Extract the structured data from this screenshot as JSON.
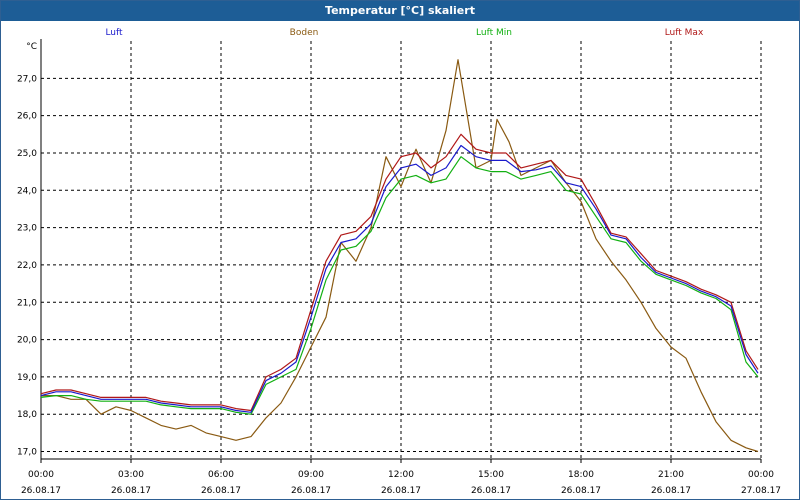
{
  "title": "Temperatur [°C] skaliert",
  "colors": {
    "titlebar": "#1d5d96",
    "luft": "#1a1acc",
    "boden": "#8a5a12",
    "luft_min": "#12b012",
    "luft_max": "#b01818"
  },
  "chart_data": {
    "type": "line",
    "title": "Temperatur [°C] skaliert",
    "ylabel": "°C",
    "ylim": [
      16.8,
      28.0
    ],
    "xlim_hours": [
      0,
      24
    ],
    "grid": true,
    "legend_placement": "top",
    "y_ticks": [
      "17,0",
      "18,0",
      "19,0",
      "20,0",
      "21,0",
      "22,0",
      "23,0",
      "24,0",
      "25,0",
      "26,0",
      "27,0"
    ],
    "x_ticks": [
      {
        "time": "00:00",
        "date": "26.08.17"
      },
      {
        "time": "03:00",
        "date": "26.08.17"
      },
      {
        "time": "06:00",
        "date": "26.08.17"
      },
      {
        "time": "09:00",
        "date": "26.08.17"
      },
      {
        "time": "12:00",
        "date": "26.08.17"
      },
      {
        "time": "15:00",
        "date": "26.08.17"
      },
      {
        "time": "18:00",
        "date": "26.08.17"
      },
      {
        "time": "21:00",
        "date": "26.08.17"
      },
      {
        "time": "00:00",
        "date": "27.08.17"
      }
    ],
    "series": [
      {
        "name": "Luft",
        "color": "#1a1acc",
        "x": [
          0.0,
          0.5,
          1.0,
          1.5,
          2.0,
          2.5,
          3.0,
          3.5,
          4.0,
          4.5,
          5.0,
          5.5,
          6.0,
          6.5,
          7.0,
          7.5,
          8.0,
          8.5,
          9.0,
          9.5,
          10.0,
          10.5,
          11.0,
          11.5,
          12.0,
          12.5,
          13.0,
          13.5,
          14.0,
          14.5,
          15.0,
          15.5,
          16.0,
          16.5,
          17.0,
          17.5,
          18.0,
          18.5,
          19.0,
          19.5,
          20.0,
          20.5,
          21.0,
          21.5,
          22.0,
          22.5,
          23.0,
          23.5,
          23.9
        ],
        "y": [
          18.5,
          18.6,
          18.6,
          18.5,
          18.4,
          18.4,
          18.4,
          18.4,
          18.3,
          18.25,
          18.2,
          18.2,
          18.2,
          18.1,
          18.05,
          18.9,
          19.1,
          19.4,
          20.6,
          21.9,
          22.6,
          22.7,
          23.1,
          24.1,
          24.6,
          24.7,
          24.4,
          24.6,
          25.2,
          24.9,
          24.8,
          24.8,
          24.5,
          24.55,
          24.65,
          24.2,
          24.1,
          23.5,
          22.8,
          22.7,
          22.2,
          21.8,
          21.65,
          21.5,
          21.3,
          21.15,
          20.9,
          19.6,
          19.1
        ]
      },
      {
        "name": "Boden",
        "color": "#8a5a12",
        "x": [
          0.0,
          0.5,
          1.0,
          1.5,
          2.0,
          2.5,
          3.0,
          3.5,
          4.0,
          4.5,
          5.0,
          5.5,
          6.0,
          6.5,
          7.0,
          7.5,
          8.0,
          8.5,
          9.0,
          9.5,
          10.0,
          10.5,
          11.0,
          11.5,
          12.0,
          12.5,
          13.0,
          13.5,
          13.9,
          14.5,
          15.0,
          15.2,
          15.6,
          16.0,
          16.5,
          17.0,
          17.5,
          18.0,
          18.5,
          19.0,
          19.5,
          20.0,
          20.5,
          21.0,
          21.5,
          22.0,
          22.5,
          23.0,
          23.5,
          23.9
        ],
        "y": [
          18.5,
          18.5,
          18.4,
          18.4,
          18.0,
          18.2,
          18.1,
          17.9,
          17.7,
          17.6,
          17.7,
          17.5,
          17.4,
          17.3,
          17.4,
          17.9,
          18.3,
          19.0,
          19.8,
          20.6,
          22.6,
          22.1,
          23.0,
          24.9,
          24.1,
          25.1,
          24.2,
          25.6,
          27.5,
          24.6,
          24.8,
          25.9,
          25.3,
          24.4,
          24.6,
          24.8,
          24.2,
          23.7,
          22.7,
          22.1,
          21.6,
          21.0,
          20.3,
          19.8,
          19.5,
          18.6,
          17.8,
          17.3,
          17.1,
          17.0
        ]
      },
      {
        "name": "Luft Min",
        "color": "#12b012",
        "x": [
          0.0,
          0.5,
          1.0,
          1.5,
          2.0,
          2.5,
          3.0,
          3.5,
          4.0,
          4.5,
          5.0,
          5.5,
          6.0,
          6.5,
          7.0,
          7.5,
          8.0,
          8.5,
          9.0,
          9.5,
          10.0,
          10.5,
          11.0,
          11.5,
          12.0,
          12.5,
          13.0,
          13.5,
          14.0,
          14.5,
          15.0,
          15.5,
          16.0,
          16.5,
          17.0,
          17.5,
          18.0,
          18.5,
          19.0,
          19.5,
          20.0,
          20.5,
          21.0,
          21.5,
          22.0,
          22.5,
          23.0,
          23.5,
          23.9
        ],
        "y": [
          18.45,
          18.5,
          18.5,
          18.4,
          18.35,
          18.35,
          18.35,
          18.35,
          18.25,
          18.2,
          18.15,
          18.15,
          18.15,
          18.05,
          18.0,
          18.8,
          19.0,
          19.2,
          20.3,
          21.6,
          22.4,
          22.5,
          22.9,
          23.8,
          24.3,
          24.4,
          24.2,
          24.3,
          24.9,
          24.6,
          24.5,
          24.5,
          24.3,
          24.4,
          24.5,
          24.0,
          23.9,
          23.3,
          22.7,
          22.6,
          22.1,
          21.75,
          21.6,
          21.45,
          21.25,
          21.1,
          20.8,
          19.4,
          19.0
        ]
      },
      {
        "name": "Luft Max",
        "color": "#b01818",
        "x": [
          0.0,
          0.5,
          1.0,
          1.5,
          2.0,
          2.5,
          3.0,
          3.5,
          4.0,
          4.5,
          5.0,
          5.5,
          6.0,
          6.5,
          7.0,
          7.5,
          8.0,
          8.5,
          9.0,
          9.5,
          10.0,
          10.5,
          11.0,
          11.5,
          12.0,
          12.5,
          13.0,
          13.5,
          14.0,
          14.5,
          15.0,
          15.5,
          16.0,
          16.5,
          17.0,
          17.5,
          18.0,
          18.5,
          19.0,
          19.5,
          20.0,
          20.5,
          21.0,
          21.5,
          22.0,
          22.5,
          23.0,
          23.5,
          23.9
        ],
        "y": [
          18.55,
          18.65,
          18.65,
          18.55,
          18.45,
          18.45,
          18.45,
          18.45,
          18.35,
          18.3,
          18.25,
          18.25,
          18.25,
          18.15,
          18.1,
          19.0,
          19.2,
          19.5,
          20.8,
          22.1,
          22.8,
          22.9,
          23.3,
          24.3,
          24.9,
          25.0,
          24.6,
          24.9,
          25.5,
          25.1,
          25.0,
          25.0,
          24.6,
          24.7,
          24.8,
          24.4,
          24.3,
          23.6,
          22.85,
          22.75,
          22.3,
          21.85,
          21.7,
          21.55,
          21.35,
          21.2,
          21.0,
          19.7,
          19.2
        ]
      }
    ]
  }
}
